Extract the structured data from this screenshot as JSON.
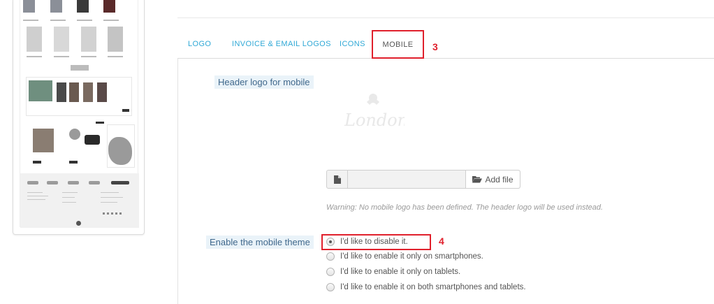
{
  "tabs": [
    {
      "label": "LOGO"
    },
    {
      "label": "INVOICE & EMAIL LOGOS"
    },
    {
      "label": "ICONS"
    },
    {
      "label": "MOBILE",
      "active": true
    }
  ],
  "annotations": {
    "tab_callout": "3",
    "radio_callout": "4"
  },
  "mobile_logo": {
    "label": "Header logo for mobile",
    "placeholder_logo_text": "London",
    "add_file_label": "Add file",
    "file_icon": "file-icon",
    "folder_icon": "folder-open-icon",
    "warning": "Warning: No mobile logo has been defined. The header logo will be used instead."
  },
  "mobile_theme": {
    "label": "Enable the mobile theme",
    "options": [
      {
        "label": "I'd like to disable it.",
        "checked": true
      },
      {
        "label": "I'd like to enable it only on smartphones.",
        "checked": false
      },
      {
        "label": "I'd like to enable it only on tablets.",
        "checked": false
      },
      {
        "label": "I'd like to enable it on both smartphones and tablets.",
        "checked": false
      }
    ]
  },
  "colors": {
    "accent": "#2fa8d6",
    "annotation": "#e0202c",
    "label_bg": "#eaf3f9"
  }
}
